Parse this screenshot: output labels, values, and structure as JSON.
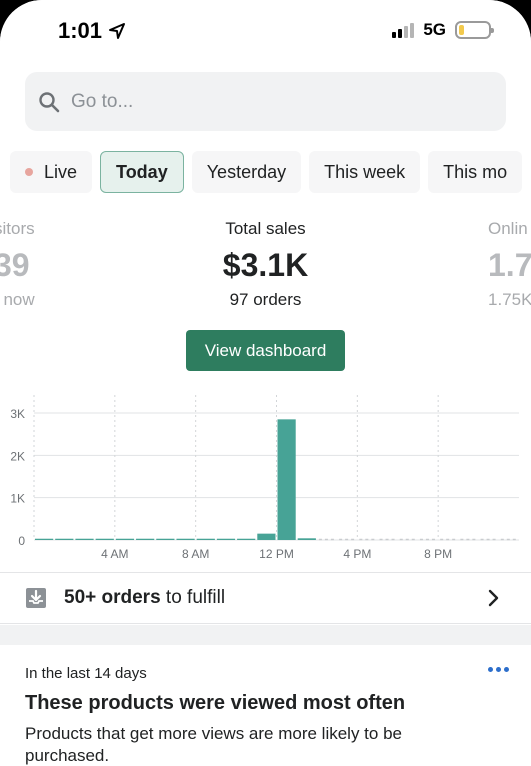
{
  "status_bar": {
    "time": "1:01",
    "network": "5G"
  },
  "search": {
    "placeholder": "Go to..."
  },
  "tabs": [
    {
      "label": "Live"
    },
    {
      "label": "Today"
    },
    {
      "label": "Yesterday"
    },
    {
      "label": "This week"
    },
    {
      "label": "This mo"
    }
  ],
  "stats": {
    "visitors": {
      "label": "sitors",
      "value": "39",
      "sub": "t now"
    },
    "total_sales": {
      "label": "Total sales",
      "value": "$3.1K",
      "sub": "97 orders"
    },
    "online": {
      "label": "Onlin",
      "value": "1.7",
      "sub": "1.75K"
    }
  },
  "dashboard_button": {
    "label": "View dashboard"
  },
  "colors": {
    "accent": "#2e7d5f",
    "bar": "#47a396",
    "active_tab_bg": "#e6f1ed",
    "link": "#2c6ecb"
  },
  "chart_data": {
    "type": "bar",
    "x_tick_labels": [
      "4 AM",
      "8 AM",
      "12 PM",
      "4 PM",
      "8 PM"
    ],
    "y_tick_labels": [
      "3K",
      "2K",
      "1K",
      "0"
    ],
    "ylim": [
      0,
      3000
    ],
    "grid": true,
    "categories": [
      "0",
      "1",
      "2",
      "3",
      "4",
      "5",
      "6",
      "7",
      "8",
      "9",
      "10",
      "11",
      "12",
      "13",
      "14",
      "15",
      "16",
      "17",
      "18",
      "19",
      "20",
      "21",
      "22",
      "23"
    ],
    "values": [
      30,
      30,
      30,
      30,
      30,
      30,
      30,
      30,
      30,
      30,
      30,
      150,
      2850,
      40,
      0,
      0,
      0,
      0,
      0,
      0,
      0,
      0,
      0,
      0
    ]
  },
  "fulfill": {
    "count": "50+ orders",
    "rest": " to fulfill"
  },
  "products_card": {
    "eyebrow": "In the last 14 days",
    "title": "These products were viewed most often",
    "description": "Products that get more views are more likely to be purchased."
  }
}
